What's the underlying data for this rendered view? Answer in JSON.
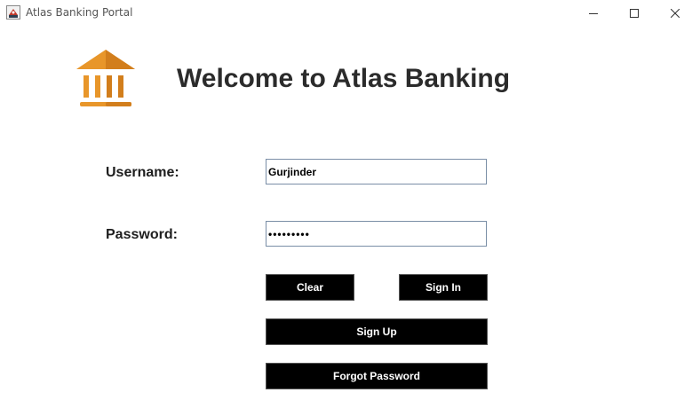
{
  "window": {
    "title": "Atlas Banking Portal",
    "controls": [
      "minimize",
      "maximize",
      "close"
    ]
  },
  "header": {
    "logo_icon": "bank-building-icon",
    "logo_color": "#E8962A",
    "welcome": "Welcome to Atlas Banking"
  },
  "form": {
    "username_label": "Username:",
    "username_value": "Gurjinder",
    "password_label": "Password:",
    "password_value": "•••••••••"
  },
  "buttons": {
    "clear": "Clear",
    "sign_in": "Sign In",
    "sign_up": "Sign Up",
    "forgot_password": "Forgot Password"
  }
}
